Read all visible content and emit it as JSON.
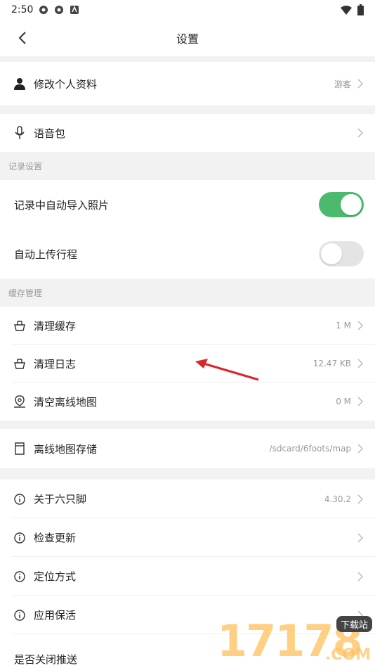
{
  "status_bar": {
    "time": "2:50"
  },
  "nav": {
    "title": "设置"
  },
  "profile": {
    "label": "修改个人资料",
    "value": "游客"
  },
  "voice": {
    "label": "语音包"
  },
  "record_section": {
    "header": "记录设置",
    "items": [
      {
        "label": "记录中自动导入照片",
        "enabled": true
      },
      {
        "label": "自动上传行程",
        "enabled": false
      }
    ]
  },
  "cache_section": {
    "header": "缓存管理",
    "items": [
      {
        "label": "清理缓存",
        "value": "1 M",
        "icon": "basket-icon"
      },
      {
        "label": "清理日志",
        "value": "12.47 KB",
        "icon": "basket-icon"
      },
      {
        "label": "清空离线地图",
        "value": "0 M",
        "icon": "map-pin-icon"
      }
    ]
  },
  "storage": {
    "label": "离线地图存储",
    "value": "/sdcard/6foots/map"
  },
  "about_section": {
    "items": [
      {
        "label": "关于六只脚",
        "value": "4.30.2"
      },
      {
        "label": "检查更新",
        "value": ""
      },
      {
        "label": "定位方式",
        "value": ""
      },
      {
        "label": "应用保活",
        "value": ""
      }
    ]
  },
  "push": {
    "label": "是否关闭推送"
  },
  "watermark": {
    "digits": "17178",
    "badge": "下载站",
    "domain": ".COM"
  },
  "colors": {
    "toggle_on": "#4cba6e",
    "annotation_arrow": "#d9262b"
  }
}
